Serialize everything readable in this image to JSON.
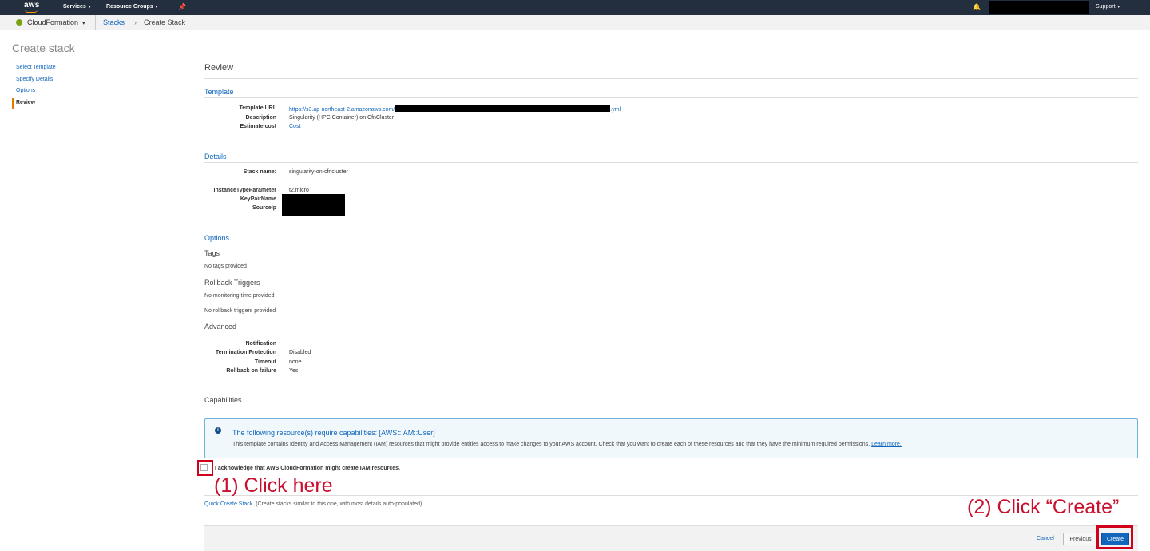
{
  "topnav": {
    "logo": "aws",
    "services": "Services",
    "resource_groups": "Resource Groups",
    "support": "Support",
    "caret": "▾",
    "pin_glyph": "📌",
    "bell_glyph": "🔔"
  },
  "servicebar": {
    "service": "CloudFormation",
    "breadcrumb_stacks": "Stacks",
    "breadcrumb_sep": "›",
    "breadcrumb_current": "Create Stack"
  },
  "sidebar": {
    "title": "Create stack",
    "steps": [
      {
        "label": "Select Template"
      },
      {
        "label": "Specify Details"
      },
      {
        "label": "Options"
      },
      {
        "label": "Review"
      }
    ]
  },
  "review": {
    "heading": "Review",
    "template": {
      "title": "Template",
      "url_label": "Template URL",
      "url_prefix": "https://s3.ap-northeast-2.amazonaws.com/",
      "url_suffix": ".yml",
      "description_label": "Description",
      "description_value": "Singularity (HPC Container) on CfnCluster",
      "cost_label": "Estimate cost",
      "cost_value": "Cost"
    },
    "details": {
      "title": "Details",
      "stack_name_label": "Stack name:",
      "stack_name_value": "singularity-on-cfncluster",
      "instance_type_label": "InstanceTypeParameter",
      "instance_type_value": "t2.micro",
      "keypair_label": "KeyPairName",
      "sourceip_label": "SourceIp"
    },
    "options": {
      "title": "Options",
      "tags_title": "Tags",
      "tags_value": "No tags provided",
      "rollback_title": "Rollback Triggers",
      "monitoring_value": "No monitoring time provided",
      "triggers_value": "No rollback triggers provided",
      "advanced_title": "Advanced",
      "notification_label": "Notification",
      "termination_label": "Termination Protection",
      "termination_value": "Disabled",
      "timeout_label": "Timeout",
      "timeout_value": "none",
      "rollback_failure_label": "Rollback on failure",
      "rollback_failure_value": "Yes"
    },
    "capabilities": {
      "title": "Capabilities",
      "info_glyph": "i",
      "info_title": "The following resource(s) require capabilities: [AWS::IAM::User]",
      "info_body": "This template contains Identity and Access Management (IAM) resources that might provide entities access to make changes to your AWS account. Check that you want to create each of these resources and that they have the minimum required permissions.",
      "learn_more": "Learn more.",
      "acknowledge": "I acknowledge that AWS CloudFormation might create IAM resources."
    },
    "quick_create": {
      "link": "Quick Create Stack",
      "note": "(Create stacks similar to this one, with most details auto-populated)"
    }
  },
  "annotations": {
    "step1": "(1) Click here",
    "step2": "(2) Click “Create”"
  },
  "footer": {
    "cancel": "Cancel",
    "previous": "Previous",
    "create": "Create"
  }
}
